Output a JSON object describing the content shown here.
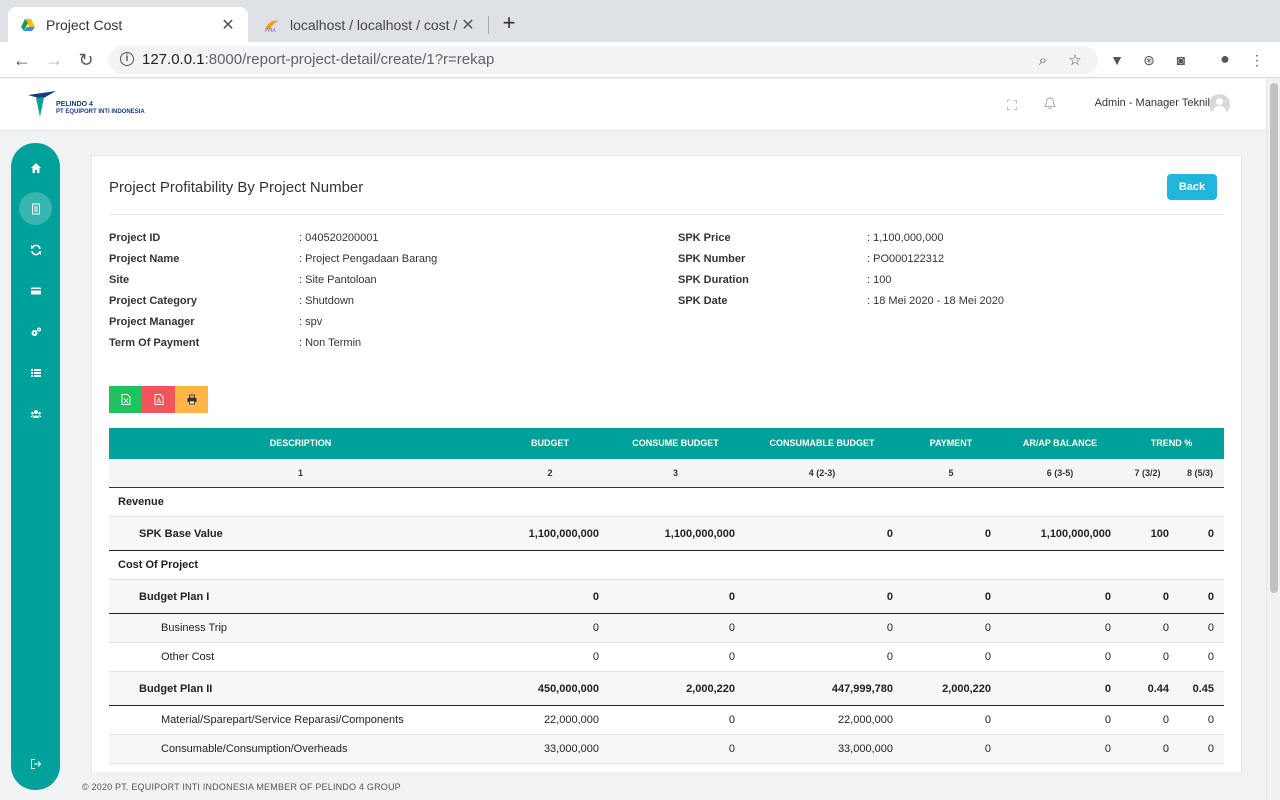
{
  "browser": {
    "tabs": [
      {
        "title": "Project Cost",
        "icon": "google-drive-icon",
        "active": true
      },
      {
        "title": "localhost / localhost / cost / tra",
        "icon": "phpmyadmin-icon",
        "active": false
      }
    ],
    "url_host": "127.0.0.1",
    "url_path": ":8000/report-project-detail/create/1?r=rekap"
  },
  "header": {
    "logo_line1": "PELINDO 4",
    "logo_line2": "PT EQUIPORT INTI INDONESIA",
    "user": "Admin - Manager Teknik"
  },
  "sidebar": {
    "items": [
      {
        "icon": "home-icon",
        "active": false
      },
      {
        "icon": "document-icon",
        "active": true
      },
      {
        "icon": "refresh-icon",
        "active": false
      },
      {
        "icon": "credit-card-icon",
        "active": false
      },
      {
        "icon": "gears-icon",
        "active": false
      },
      {
        "icon": "list-icon",
        "active": false
      },
      {
        "icon": "users-icon",
        "active": false
      }
    ],
    "logout_icon": "sign-out-icon"
  },
  "page": {
    "title": "Project Profitability By Project Number",
    "back_label": "Back"
  },
  "info_left": [
    {
      "label": "Project ID",
      "value": ": 040520200001"
    },
    {
      "label": "Project Name",
      "value": ": Project Pengadaan Barang"
    },
    {
      "label": "Site",
      "value": ": Site Pantoloan"
    },
    {
      "label": "Project Category",
      "value": ": Shutdown"
    },
    {
      "label": "Project Manager",
      "value": ": spv"
    },
    {
      "label": "Term Of Payment",
      "value": ": Non Termin"
    }
  ],
  "info_right": [
    {
      "label": "SPK Price",
      "value": ": 1,100,000,000"
    },
    {
      "label": "SPK Number",
      "value": ": PO000122312"
    },
    {
      "label": "SPK Duration",
      "value": ": 100"
    },
    {
      "label": "SPK Date",
      "value": ": 18 Mei 2020 - 18 Mei 2020"
    }
  ],
  "export_buttons": [
    {
      "name": "export-excel-button",
      "icon": "file-excel-icon",
      "color": "#1fc25c"
    },
    {
      "name": "export-pdf-button",
      "icon": "file-pdf-icon",
      "color": "#f2545b"
    },
    {
      "name": "print-button",
      "icon": "print-icon",
      "color": "#ffb547"
    }
  ],
  "table": {
    "headers": [
      "DESCRIPTION",
      "BUDGET",
      "CONSUME BUDGET",
      "CONSUMABLE BUDGET",
      "PAYMENT",
      "AR/AP BALANCE",
      "TREND %"
    ],
    "numbers": [
      "1",
      "2",
      "3",
      "4 (2-3)",
      "5",
      "6 (3-5)",
      "7 (3/2)",
      "8 (5/3)"
    ],
    "rows": [
      {
        "level": 0,
        "desc": "Revenue",
        "cells": []
      },
      {
        "level": 1,
        "desc": "SPK Base Value",
        "cells": [
          "1,100,000,000",
          "1,100,000,000",
          "0",
          "0",
          "1,100,000,000",
          "100",
          "0"
        ]
      },
      {
        "level": 0,
        "desc": "Cost Of Project",
        "cells": []
      },
      {
        "level": 1,
        "desc": "Budget Plan I",
        "cells": [
          "0",
          "0",
          "0",
          "0",
          "0",
          "0",
          "0"
        ]
      },
      {
        "level": 2,
        "desc": "Business Trip",
        "cells": [
          "0",
          "0",
          "0",
          "0",
          "0",
          "0",
          "0"
        ]
      },
      {
        "level": 2,
        "desc": "Other Cost",
        "cells": [
          "0",
          "0",
          "0",
          "0",
          "0",
          "0",
          "0"
        ]
      },
      {
        "level": 1,
        "desc": "Budget Plan II",
        "cells": [
          "450,000,000",
          "2,000,220",
          "447,999,780",
          "2,000,220",
          "0",
          "0.44",
          "0.45"
        ]
      },
      {
        "level": 2,
        "desc": "Material/Sparepart/Service Reparasi/Components",
        "cells": [
          "22,000,000",
          "0",
          "22,000,000",
          "0",
          "0",
          "0",
          "0"
        ]
      },
      {
        "level": 2,
        "desc": "Consumable/Consumption/Overheads",
        "cells": [
          "33,000,000",
          "0",
          "33,000,000",
          "0",
          "0",
          "0",
          "0"
        ]
      }
    ]
  },
  "footer": {
    "text": "© 2020 PT. EQUIPORT INTI INDONESIA MEMBER OF PELINDO 4 GROUP"
  },
  "colors": {
    "teal": "#00a19a",
    "back_button": "#1fb5dc"
  }
}
